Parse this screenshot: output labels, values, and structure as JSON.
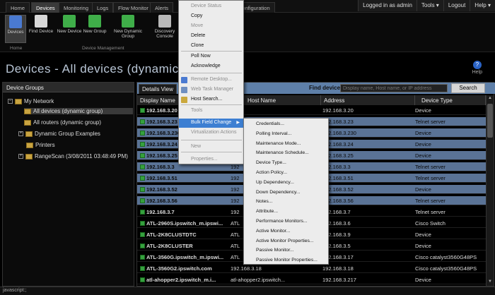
{
  "topnav": {
    "tabs": [
      "Home",
      "Devices",
      "Monitoring",
      "Logs",
      "Flow Monitor",
      "Alerts",
      "Configuration"
    ],
    "active_tab": "Devices",
    "user": "Logged in as admin",
    "tools": "Tools ▾",
    "logout": "Logout",
    "help": "Help ▾"
  },
  "toolbar": {
    "buttons": [
      "Devices",
      "Find Device",
      "New Device",
      "New Group",
      "New Dynamic Group",
      "Discovery Console"
    ],
    "group_home": "Home",
    "group_mgmt": "Device Management"
  },
  "page": {
    "title": "Devices - All devices (dynamic gro",
    "help_label": "Help"
  },
  "left_panel": {
    "title": "Device Groups",
    "tree": [
      {
        "label": "My Network",
        "expanded": true
      },
      {
        "label": "All devices (dynamic group)",
        "selected": true
      },
      {
        "label": "All routers (dynamic group)"
      },
      {
        "label": "Dynamic Group Examples",
        "expander": "+"
      },
      {
        "label": "Printers"
      },
      {
        "label": "RangeScan (3/08/2011 03:48:49 PM)",
        "expander": "+"
      }
    ]
  },
  "right_panel": {
    "tab": "Details View",
    "find_label": "Find device:",
    "find_placeholder": "Display name, Host name, or IP address",
    "search_button": "Search",
    "columns": [
      "Display Name",
      "Host Name",
      "Address",
      "Device Type"
    ],
    "rows": [
      {
        "name": "192.168.3.20",
        "host": "",
        "addr": "192.168.3.20",
        "type": "Device",
        "hl": false
      },
      {
        "name": "192.168.3.23",
        "host": "",
        "addr": "192.168.3.23",
        "type": "Telnet server",
        "hl": true
      },
      {
        "name": "192.168.3.230",
        "host": "",
        "addr": "192.168.3.230",
        "type": "Device",
        "hl": true
      },
      {
        "name": "192.168.3.24",
        "host": "",
        "addr": "192.168.3.24",
        "type": "Device",
        "hl": true
      },
      {
        "name": "192.168.3.25",
        "host": "",
        "addr": "192.168.3.25",
        "type": "Device",
        "hl": true
      },
      {
        "name": "192.168.3.3",
        "host": "192",
        "addr": "192.168.3.3",
        "type": "Telnet server",
        "hl": true
      },
      {
        "name": "192.168.3.51",
        "host": "192",
        "addr": "192.168.3.51",
        "type": "Telnet server",
        "hl": true
      },
      {
        "name": "192.168.3.52",
        "host": "192",
        "addr": "192.168.3.52",
        "type": "Device",
        "hl": true
      },
      {
        "name": "192.168.3.56",
        "host": "192",
        "addr": "192.168.3.56",
        "type": "Telnet server",
        "hl": true
      },
      {
        "name": "192.168.3.7",
        "host": "192",
        "addr": "192.168.3.7",
        "type": "Telnet server",
        "hl": false
      },
      {
        "name": "ATL-2960S.ipswitch_m.ipswi...",
        "host": "ATL",
        "addr": "192.168.3.6",
        "type": "Cisco Switch",
        "hl": false
      },
      {
        "name": "ATL-2K8CLUSTDTC",
        "host": "ATL",
        "addr": "192.168.3.9",
        "type": "Device",
        "hl": false
      },
      {
        "name": "ATL-2K8CLUSTER",
        "host": "ATL",
        "addr": "192.168.3.5",
        "type": "Device",
        "hl": false
      },
      {
        "name": "ATL-3560G.ipswitch_m.ipswi...",
        "host": "ATL",
        "addr": "192.168.3.17",
        "type": "Cisco catalyst3560G48PS",
        "hl": false
      },
      {
        "name": "ATL-3560G2.ipswitch.com",
        "host": "192.168.3.18",
        "addr": "192.168.3.18",
        "type": "Cisco catalyst3560G48PS",
        "hl": false
      },
      {
        "name": "atl-ahopper2.ipswitch_m.i...",
        "host": "atl-ahopper2.ipswitch...",
        "addr": "192.168.3.217",
        "type": "Device",
        "hl": false
      }
    ]
  },
  "context_menu": {
    "items": [
      {
        "label": "Device Status",
        "disabled": true
      },
      {
        "label": "Copy"
      },
      {
        "label": "Move",
        "disabled": true
      },
      {
        "label": "Delete"
      },
      {
        "label": "Clone"
      },
      {
        "label": "Poll Now"
      },
      {
        "label": "Acknowledge"
      },
      {
        "label": "Remote Desktop...",
        "disabled": true
      },
      {
        "label": "Web Task Manager",
        "disabled": true
      },
      {
        "label": "Host Search..."
      },
      {
        "label": "Tools",
        "disabled": true
      },
      {
        "label": "Bulk Field Change",
        "active": true
      },
      {
        "label": "Virtualization Actions",
        "disabled": true
      },
      {
        "label": "New",
        "disabled": true
      },
      {
        "label": "Properties...",
        "disabled": true
      }
    ]
  },
  "submenu": {
    "items": [
      "Credentials...",
      "Polling Interval...",
      "Maintenance Mode...",
      "Maintenance Schedule...",
      "Device Type...",
      "Action Policy...",
      "Up Dependency...",
      "Down Dependency...",
      "Notes...",
      "Attribute...",
      "Performance Monitors...",
      "Active Monitor...",
      "Active Monitor Properties...",
      "Passive Monitor...",
      "Passive Monitor Properties..."
    ]
  },
  "status": "javascript:;",
  "colors": {
    "accent": "#3d7fd2",
    "row_highlight": "#5a7396",
    "tab_bar": "#5e7fa8",
    "device_icon": "#36a13e"
  }
}
